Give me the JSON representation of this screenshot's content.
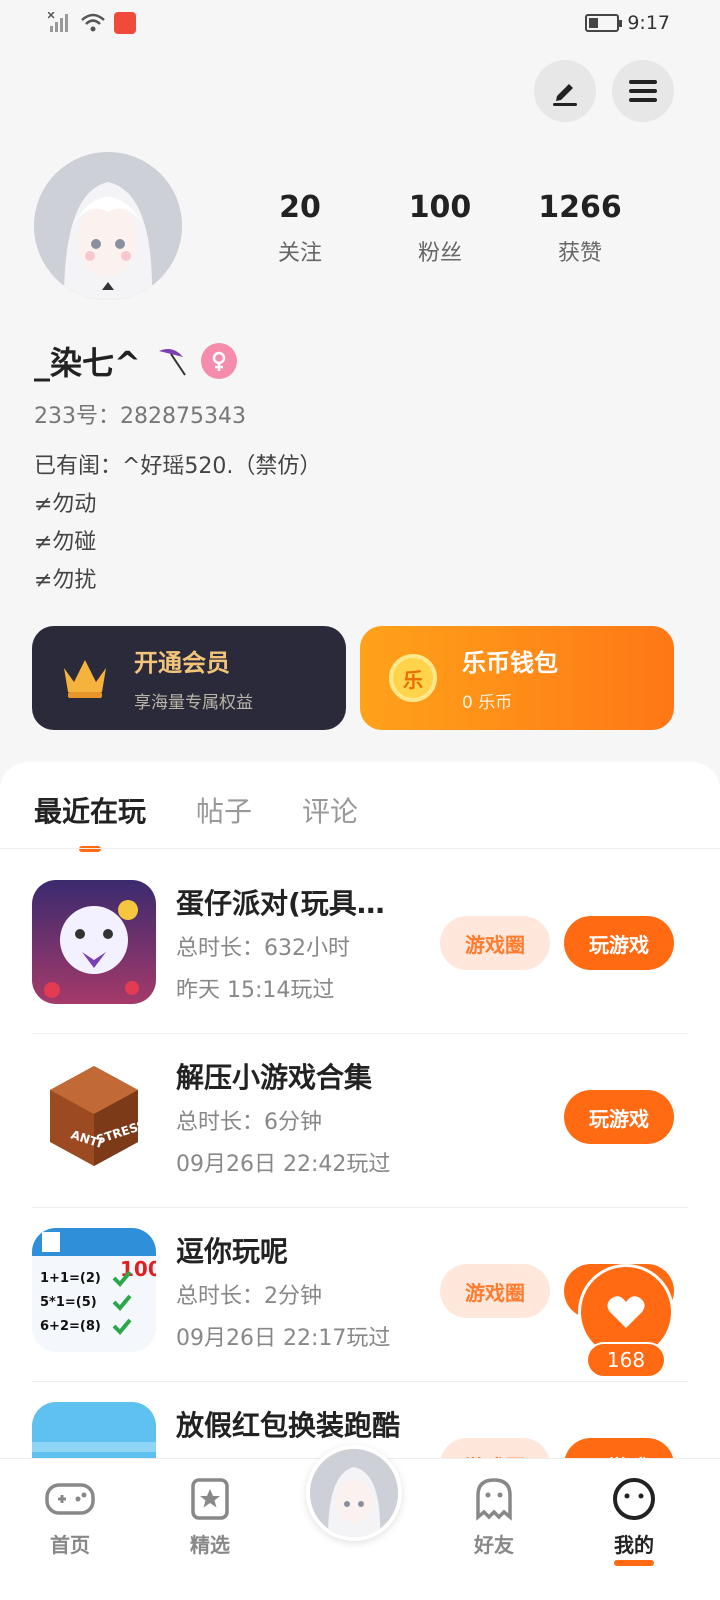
{
  "status_bar": {
    "time": "9:17",
    "icons": [
      "signal-icon",
      "wifi-icon",
      "app-badge-icon",
      "battery-icon"
    ]
  },
  "header": {
    "edit_icon": "pen-icon",
    "menu_icon": "hamburger-menu-icon"
  },
  "profile": {
    "stats": [
      {
        "value": "20",
        "label": "关注"
      },
      {
        "value": "100",
        "label": "粉丝"
      },
      {
        "value": "1266",
        "label": "获赞"
      }
    ],
    "username": "_染七^",
    "gender": "female",
    "id_line": "233号：282875343",
    "bio": [
      "已有闺：^好瑶520.（禁仿）",
      "≠勿动",
      "≠勿碰",
      "≠勿扰"
    ]
  },
  "cards": {
    "vip": {
      "title": "开通会员",
      "subtitle": "享海量专属权益"
    },
    "wallet": {
      "coin_char": "乐",
      "title": "乐币钱包",
      "subtitle": "0 乐币"
    }
  },
  "tabs": [
    {
      "label": "最近在玩",
      "active": true
    },
    {
      "label": "帖子",
      "active": false
    },
    {
      "label": "评论",
      "active": false
    }
  ],
  "games": [
    {
      "title": "蛋仔派对(玩具…",
      "duration": "总时长：632小时",
      "last_played": "昨天 15:14玩过",
      "community_label": "游戏圈",
      "play_label": "玩游戏"
    },
    {
      "title": "解压小游戏合集",
      "duration": "总时长：6分钟",
      "last_played": "09月26日 22:42玩过",
      "play_label": "玩游戏",
      "icon_text": [
        "ANTI",
        "STRESS"
      ]
    },
    {
      "title": "逗你玩呢",
      "duration": "总时长：2分钟",
      "last_played": "09月26日 22:17玩过",
      "community_label": "游戏圈",
      "play_label": "玩游戏",
      "icon_text": [
        "1+1=(2)",
        "5*1=(5)",
        "6+2=(8)",
        "100"
      ]
    },
    {
      "title": "放假红包换装跑酷",
      "duration": "",
      "last_played": "",
      "community_label": "游戏圈",
      "play_label": "玩游戏"
    }
  ],
  "floating_like": {
    "count": "168"
  },
  "bottom_nav": [
    {
      "label": "首页",
      "icon": "gamepad-icon",
      "active": false
    },
    {
      "label": "精选",
      "icon": "star-card-icon",
      "active": false
    },
    {
      "label": "好友",
      "icon": "ghost-icon",
      "active": false
    },
    {
      "label": "我的",
      "icon": "smiley-face-icon",
      "active": true
    }
  ],
  "colors": {
    "accent": "#ff6a13",
    "vip_bg": "#2b2a3a",
    "vip_gold": "#f2c57a",
    "community_bg": "#ffe7db"
  }
}
